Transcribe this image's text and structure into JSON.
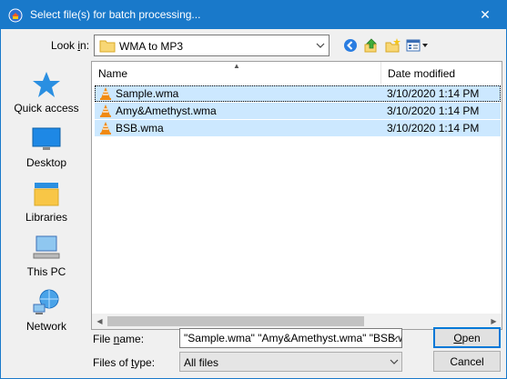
{
  "window": {
    "title": "Select file(s) for batch processing...",
    "close_glyph": "✕"
  },
  "toolbar": {
    "lookin_label_pre": "Look ",
    "lookin_label_ul": "i",
    "lookin_label_post": "n:",
    "lookin_value": "WMA to MP3",
    "icons": [
      "back-icon",
      "up-folder-icon",
      "new-folder-icon",
      "view-menu-icon"
    ]
  },
  "places": [
    {
      "label": "Quick access",
      "icon": "quick-access-star-icon"
    },
    {
      "label": "Desktop",
      "icon": "desktop-icon"
    },
    {
      "label": "Libraries",
      "icon": "libraries-icon"
    },
    {
      "label": "This PC",
      "icon": "this-pc-icon"
    },
    {
      "label": "Network",
      "icon": "network-icon"
    }
  ],
  "filelist": {
    "columns": {
      "name": "Name",
      "date": "Date modified"
    },
    "rows": [
      {
        "name": "Sample.wma",
        "date": "3/10/2020 1:14 PM",
        "icon": "vlc-cone-icon"
      },
      {
        "name": "Amy&Amethyst.wma",
        "date": "3/10/2020 1:14 PM",
        "icon": "vlc-cone-icon"
      },
      {
        "name": "BSB.wma",
        "date": "3/10/2020 1:14 PM",
        "icon": "vlc-cone-icon"
      }
    ]
  },
  "fields": {
    "filename_label_pre": "File ",
    "filename_label_ul": "n",
    "filename_label_post": "ame:",
    "filename_value": "\"Sample.wma\" \"Amy&Amethyst.wma\" \"BSB.wma\"",
    "filetype_label_pre": "Files of ",
    "filetype_label_ul": "t",
    "filetype_label_post": "ype:",
    "filetype_value": "All files"
  },
  "buttons": {
    "open_ul": "O",
    "open_rest": "pen",
    "cancel": "Cancel"
  },
  "colors": {
    "titlebar": "#1979ca",
    "selection": "#cce8ff",
    "default_button_border": "#0078d7"
  }
}
